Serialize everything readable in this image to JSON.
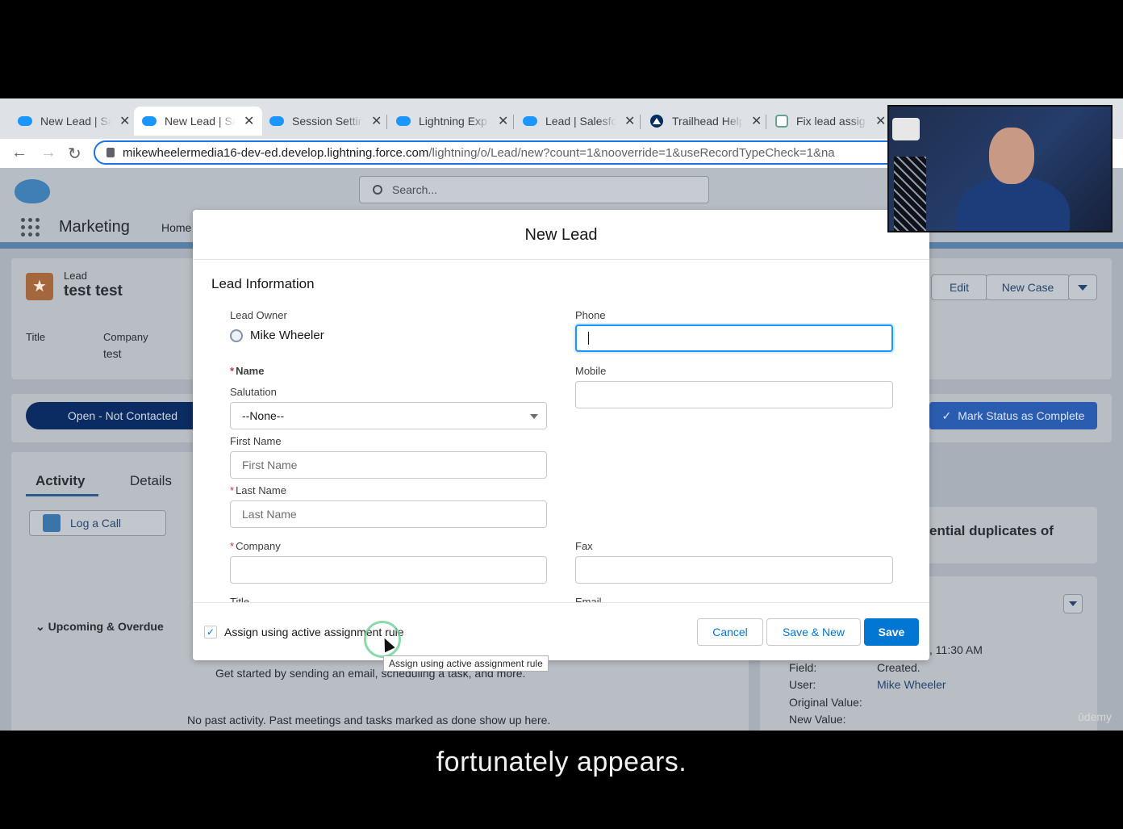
{
  "browser": {
    "tabs": [
      {
        "label": "New Lead | Sa"
      },
      {
        "label": "New Lead | Sa"
      },
      {
        "label": "Session Settin"
      },
      {
        "label": "Lightning Exp"
      },
      {
        "label": "Lead | Salesfo"
      },
      {
        "label": "Trailhead Help"
      },
      {
        "label": "Fix lead assig"
      }
    ],
    "url_host": "mikewheelermedia16-dev-ed.develop.lightning.force.com",
    "url_path": "/lightning/o/Lead/new?count=1&nooverride=1&useRecordTypeCheck=1&na"
  },
  "sf": {
    "search_placeholder": "Search...",
    "app_name": "Marketing",
    "nav_home": "Home",
    "record_type": "Lead",
    "record_name": "test test",
    "field_title_label": "Title",
    "field_company_label": "Company",
    "field_company_value": "test",
    "edit_button": "Edit",
    "new_case_button": "New Case",
    "status_open": "Open - Not Contacted",
    "mark_status": "Mark Status as Complete",
    "tab_activity": "Activity",
    "tab_details": "Details",
    "log_call": "Log a Call",
    "duplicates_text": "ential duplicates of",
    "upcoming": "Upcoming & Overdue",
    "get_started": "Get started by sending an email, scheduling a task, and more.",
    "no_past": "No past activity. Past meetings and tasks marked as done show up here.",
    "history_time": ", 11:30 AM",
    "history_field_label": "Field:",
    "history_field_value": "Created.",
    "history_user_label": "User:",
    "history_user_value": "Mike Wheeler",
    "history_orig_label": "Original Value:",
    "history_new_label": "New Value:"
  },
  "modal": {
    "title": "New Lead",
    "section": "Lead Information",
    "lead_owner_label": "Lead Owner",
    "lead_owner_value": "Mike Wheeler",
    "phone_label": "Phone",
    "mobile_label": "Mobile",
    "name_label": "Name",
    "salutation_label": "Salutation",
    "salutation_value": "--None--",
    "first_name_label": "First Name",
    "first_name_placeholder": "First Name",
    "last_name_label": "Last Name",
    "last_name_placeholder": "Last Name",
    "company_label": "Company",
    "fax_label": "Fax",
    "title_label": "Title",
    "email_label": "Email",
    "assign_rule_label": "Assign using active assignment rule",
    "assign_rule_checked": true,
    "cancel": "Cancel",
    "save_new": "Save & New",
    "save": "Save",
    "tooltip": "Assign using active assignment rule"
  },
  "overlay": {
    "caption": "fortunately appears.",
    "watermark": "ûdemy"
  }
}
